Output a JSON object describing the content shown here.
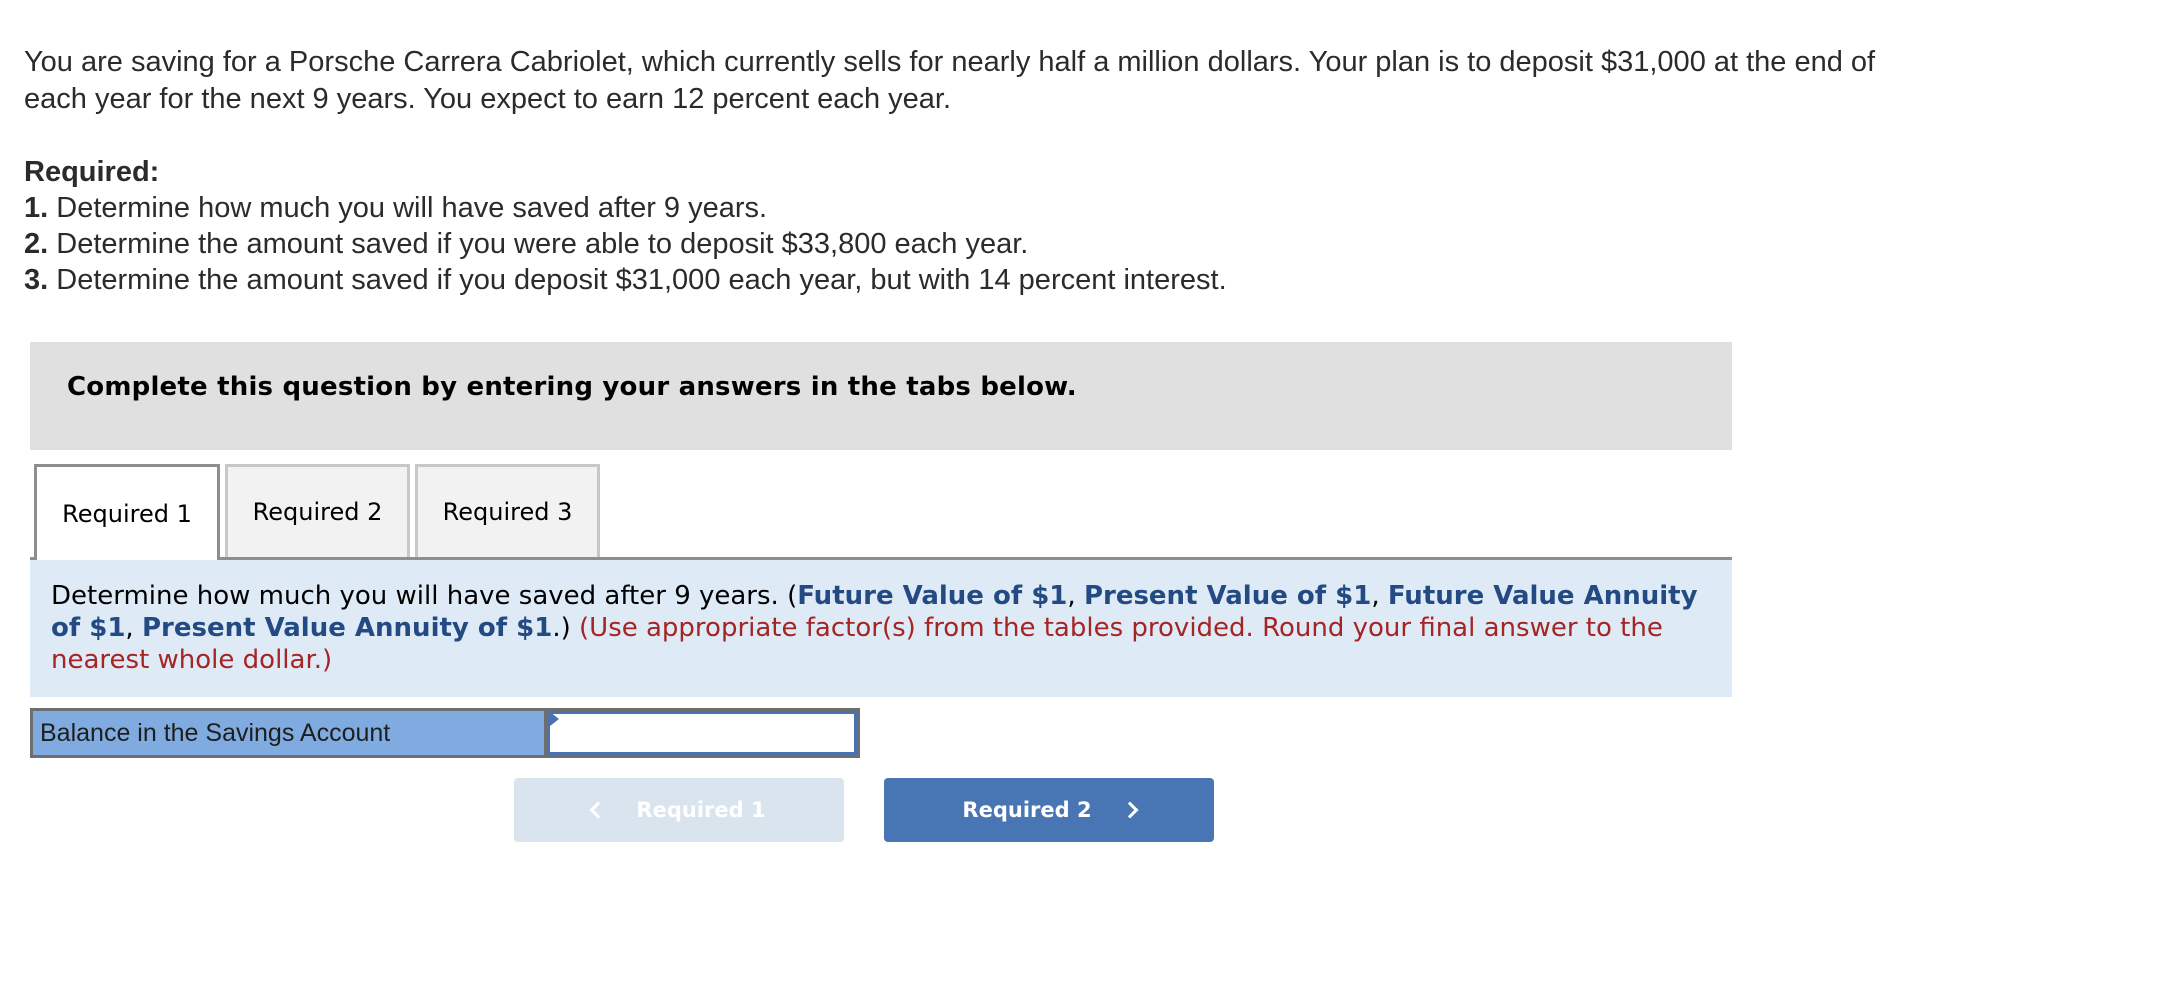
{
  "problem": {
    "text": "You are saving for a Porsche Carrera Cabriolet, which currently sells for nearly half a million dollars. Your plan is to deposit $31,000 at the end of each year for the next 9 years. You expect to earn 12 percent each year."
  },
  "required": {
    "heading": "Required:",
    "items": [
      {
        "number": "1.",
        "text": " Determine how much you will have saved after 9 years."
      },
      {
        "number": "2.",
        "text": " Determine the amount saved if you were able to deposit $33,800 each year."
      },
      {
        "number": "3.",
        "text": " Determine the amount saved if you deposit $31,000 each year, but with 14 percent interest."
      }
    ]
  },
  "banner": {
    "text": "Complete this question by entering your answers in the tabs below."
  },
  "tabs": [
    {
      "label": "Required 1",
      "active": true
    },
    {
      "label": "Required 2",
      "active": false
    },
    {
      "label": "Required 3",
      "active": false
    }
  ],
  "panel": {
    "instruction": "Determine how much you will have saved after 9 years. (",
    "links": [
      "Future Value of $1",
      "Present Value of $1",
      "Future Value Annuity of $1",
      "Present Value Annuity of $1"
    ],
    "separator": ", ",
    "close": ".) ",
    "note": "(Use appropriate factor(s) from the tables provided. Round your final answer to the nearest whole dollar.)"
  },
  "answer": {
    "label": "Balance in the Savings Account",
    "value": "",
    "placeholder": ""
  },
  "navigation": {
    "prev_label": "Required 1",
    "next_label": "Required 2",
    "prev_enabled": false,
    "next_enabled": true
  },
  "colors": {
    "link_blue": "#234a82",
    "note_red": "#a52424",
    "panel_bg": "#deebf7",
    "banner_bg": "#e0e0e0",
    "label_cell_bg": "#80abe0",
    "next_button_bg": "#4875b4",
    "prev_button_bg": "#dae4ef"
  }
}
